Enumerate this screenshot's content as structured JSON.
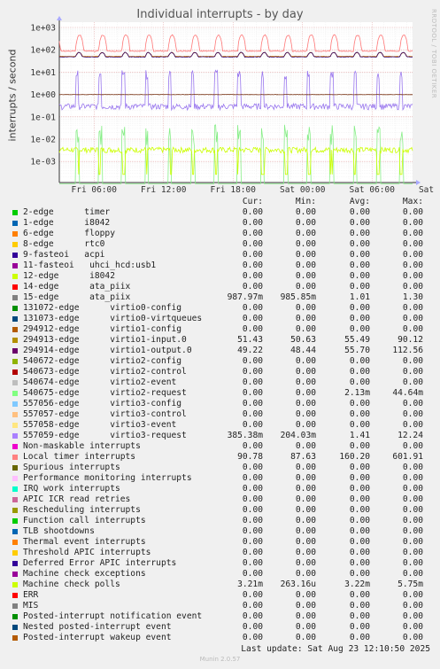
{
  "chart_data": {
    "type": "line",
    "title": "Individual interrupts - by day",
    "ylabel": "interrupts / second",
    "yscale": "log",
    "ylim": [
      0.0001,
      1500
    ],
    "y_ticks": [
      "1e+03",
      "1e+02",
      "1e+01",
      "1e+00",
      "1e-01",
      "1e-02",
      "1e-03"
    ],
    "x_ticks": [
      "Fri 06:00",
      "Fri 12:00",
      "Fri 18:00",
      "Sat 00:00",
      "Sat 06:00",
      "Sat 12:00"
    ],
    "grid": true,
    "series": [
      {
        "name": "Local timer interrupts",
        "color": "#ff7777",
        "values": [
          90.78,
          87.63,
          160.2,
          601.91
        ]
      },
      {
        "name": "294913-edge virtio1-input.0",
        "color": "#cc7700",
        "values": [
          51.43,
          50.63,
          55.49,
          90.12
        ]
      },
      {
        "name": "294914-edge virtio1-output.0",
        "color": "#330066",
        "values": [
          49.22,
          48.44,
          55.7,
          112.56
        ]
      },
      {
        "name": "15-edge ata_piix",
        "color": "#7a3a1a",
        "values": [
          0.98797,
          0.98585,
          1.01,
          1.3
        ]
      },
      {
        "name": "557059-edge virtio3-request",
        "color": "#9977ee",
        "values": [
          0.38538,
          0.20403,
          1.41,
          12.24
        ]
      },
      {
        "name": "Machine check polls",
        "color": "#ccff00",
        "values": [
          0.00321,
          0.000263,
          0.00322,
          0.00575
        ]
      },
      {
        "name": "540675-edge virtio2-request",
        "color": "#88ee88",
        "values": [
          0,
          0,
          0.00213,
          0.04464
        ]
      }
    ]
  },
  "legend": {
    "header": {
      "cur": "Cur:",
      "min": "Min:",
      "avg": "Avg:",
      "max": "Max:"
    },
    "rows": [
      {
        "color": "#00cc00",
        "label": "2-edge      timer",
        "cur": "0.00",
        "min": "0.00",
        "avg": "0.00",
        "max": "0.00"
      },
      {
        "color": "#0066b3",
        "label": "1-edge      i8042",
        "cur": "0.00",
        "min": "0.00",
        "avg": "0.00",
        "max": "0.00"
      },
      {
        "color": "#ff8000",
        "label": "6-edge      floppy",
        "cur": "0.00",
        "min": "0.00",
        "avg": "0.00",
        "max": "0.00"
      },
      {
        "color": "#ffcc00",
        "label": "8-edge      rtc0",
        "cur": "0.00",
        "min": "0.00",
        "avg": "0.00",
        "max": "0.00"
      },
      {
        "color": "#330099",
        "label": "9-fasteoi   acpi",
        "cur": "0.00",
        "min": "0.00",
        "avg": "0.00",
        "max": "0.00"
      },
      {
        "color": "#990099",
        "label": "11-fasteoi   uhci_hcd:usb1",
        "cur": "0.00",
        "min": "0.00",
        "avg": "0.00",
        "max": "0.00"
      },
      {
        "color": "#ccff00",
        "label": "12-edge      i8042",
        "cur": "0.00",
        "min": "0.00",
        "avg": "0.00",
        "max": "0.00"
      },
      {
        "color": "#ff0000",
        "label": "14-edge      ata_piix",
        "cur": "0.00",
        "min": "0.00",
        "avg": "0.00",
        "max": "0.00"
      },
      {
        "color": "#808080",
        "label": "15-edge      ata_piix",
        "cur": "987.97m",
        "min": "985.85m",
        "avg": "1.01",
        "max": "1.30"
      },
      {
        "color": "#008f00",
        "label": "131072-edge      virtio0-config",
        "cur": "0.00",
        "min": "0.00",
        "avg": "0.00",
        "max": "0.00"
      },
      {
        "color": "#00487d",
        "label": "131073-edge      virtio0-virtqueues",
        "cur": "0.00",
        "min": "0.00",
        "avg": "0.00",
        "max": "0.00"
      },
      {
        "color": "#b35a00",
        "label": "294912-edge      virtio1-config",
        "cur": "0.00",
        "min": "0.00",
        "avg": "0.00",
        "max": "0.00"
      },
      {
        "color": "#b38f00",
        "label": "294913-edge      virtio1-input.0",
        "cur": "51.43",
        "min": "50.63",
        "avg": "55.49",
        "max": "90.12"
      },
      {
        "color": "#6b006b",
        "label": "294914-edge      virtio1-output.0",
        "cur": "49.22",
        "min": "48.44",
        "avg": "55.70",
        "max": "112.56"
      },
      {
        "color": "#8fb300",
        "label": "540672-edge      virtio2-config",
        "cur": "0.00",
        "min": "0.00",
        "avg": "0.00",
        "max": "0.00"
      },
      {
        "color": "#b30000",
        "label": "540673-edge      virtio2-control",
        "cur": "0.00",
        "min": "0.00",
        "avg": "0.00",
        "max": "0.00"
      },
      {
        "color": "#bebebe",
        "label": "540674-edge      virtio2-event",
        "cur": "0.00",
        "min": "0.00",
        "avg": "0.00",
        "max": "0.00"
      },
      {
        "color": "#80ff80",
        "label": "540675-edge      virtio2-request",
        "cur": "0.00",
        "min": "0.00",
        "avg": "2.13m",
        "max": "44.64m"
      },
      {
        "color": "#80c9ff",
        "label": "557056-edge      virtio3-config",
        "cur": "0.00",
        "min": "0.00",
        "avg": "0.00",
        "max": "0.00"
      },
      {
        "color": "#ffc080",
        "label": "557057-edge      virtio3-control",
        "cur": "0.00",
        "min": "0.00",
        "avg": "0.00",
        "max": "0.00"
      },
      {
        "color": "#ffe680",
        "label": "557058-edge      virtio3-event",
        "cur": "0.00",
        "min": "0.00",
        "avg": "0.00",
        "max": "0.00"
      },
      {
        "color": "#aa80ff",
        "label": "557059-edge      virtio3-request",
        "cur": "385.38m",
        "min": "204.03m",
        "avg": "1.41",
        "max": "12.24"
      },
      {
        "color": "#ee00cc",
        "label": "Non-maskable interrupts",
        "cur": "0.00",
        "min": "0.00",
        "avg": "0.00",
        "max": "0.00"
      },
      {
        "color": "#ff8080",
        "label": "Local timer interrupts",
        "cur": "90.78",
        "min": "87.63",
        "avg": "160.20",
        "max": "601.91"
      },
      {
        "color": "#666600",
        "label": "Spurious interrupts",
        "cur": "0.00",
        "min": "0.00",
        "avg": "0.00",
        "max": "0.00"
      },
      {
        "color": "#ffbfff",
        "label": "Performance monitoring interrupts",
        "cur": "0.00",
        "min": "0.00",
        "avg": "0.00",
        "max": "0.00"
      },
      {
        "color": "#00ffcc",
        "label": "IRQ work interrupts",
        "cur": "0.00",
        "min": "0.00",
        "avg": "0.00",
        "max": "0.00"
      },
      {
        "color": "#cc6699",
        "label": "APIC ICR read retries",
        "cur": "0.00",
        "min": "0.00",
        "avg": "0.00",
        "max": "0.00"
      },
      {
        "color": "#999900",
        "label": "Rescheduling interrupts",
        "cur": "0.00",
        "min": "0.00",
        "avg": "0.00",
        "max": "0.00"
      },
      {
        "color": "#00cc00",
        "label": "Function call interrupts",
        "cur": "0.00",
        "min": "0.00",
        "avg": "0.00",
        "max": "0.00"
      },
      {
        "color": "#0066b3",
        "label": "TLB shootdowns",
        "cur": "0.00",
        "min": "0.00",
        "avg": "0.00",
        "max": "0.00"
      },
      {
        "color": "#ff8000",
        "label": "Thermal event interrupts",
        "cur": "0.00",
        "min": "0.00",
        "avg": "0.00",
        "max": "0.00"
      },
      {
        "color": "#ffcc00",
        "label": "Threshold APIC interrupts",
        "cur": "0.00",
        "min": "0.00",
        "avg": "0.00",
        "max": "0.00"
      },
      {
        "color": "#330099",
        "label": "Deferred Error APIC interrupts",
        "cur": "0.00",
        "min": "0.00",
        "avg": "0.00",
        "max": "0.00"
      },
      {
        "color": "#990099",
        "label": "Machine check exceptions",
        "cur": "0.00",
        "min": "0.00",
        "avg": "0.00",
        "max": "0.00"
      },
      {
        "color": "#ccff00",
        "label": "Machine check polls",
        "cur": "3.21m",
        "min": "263.16u",
        "avg": "3.22m",
        "max": "5.75m"
      },
      {
        "color": "#ff0000",
        "label": "ERR",
        "cur": "0.00",
        "min": "0.00",
        "avg": "0.00",
        "max": "0.00"
      },
      {
        "color": "#808080",
        "label": "MIS",
        "cur": "0.00",
        "min": "0.00",
        "avg": "0.00",
        "max": "0.00"
      },
      {
        "color": "#008f00",
        "label": "Posted-interrupt notification event",
        "cur": "0.00",
        "min": "0.00",
        "avg": "0.00",
        "max": "0.00"
      },
      {
        "color": "#00487d",
        "label": "Nested posted-interrupt event",
        "cur": "0.00",
        "min": "0.00",
        "avg": "0.00",
        "max": "0.00"
      },
      {
        "color": "#b35a00",
        "label": "Posted-interrupt wakeup event",
        "cur": "0.00",
        "min": "0.00",
        "avg": "0.00",
        "max": "0.00"
      }
    ]
  },
  "footer": {
    "last_update": "Last update: Sat Aug 23 12:10:50 2025",
    "version": "Munin 2.0.57"
  },
  "side_text": "RRDTOOL / TOBI OETIKER"
}
